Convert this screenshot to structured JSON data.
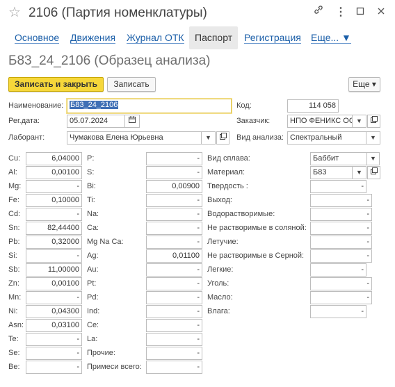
{
  "window": {
    "title": "2106 (Партия номенклатуры)",
    "star_icon": "☆",
    "link_icon": "🔗",
    "more_icon": "⋮",
    "maximize_icon": "☐",
    "close_icon": "✕"
  },
  "tabs": [
    {
      "label": "Основное"
    },
    {
      "label": "Движения"
    },
    {
      "label": "Журнал ОТК"
    },
    {
      "label": "Паспорт",
      "active": true
    },
    {
      "label": "Регистрация"
    },
    {
      "label": "Еще... ▼"
    }
  ],
  "doc_title": "Б83_24_2106 (Образец анализа)",
  "toolbar": {
    "save_close": "Записать и закрыть",
    "save": "Записать",
    "more": "Еще ▾"
  },
  "header": {
    "name_label": "Наименование:",
    "name_value": "Б83_24_2106",
    "code_label": "Код:",
    "code_value": "114 058",
    "reg_label": "Рег.дата:",
    "reg_value": "05.07.2024",
    "customer_label": "Заказчик:",
    "customer_value": "НПО ФЕНИКС ОО",
    "lab_label": "Лаборант:",
    "lab_value": "Чумакова Елена Юрьевна",
    "analysis_label": "Вид анализа:",
    "analysis_value": "Спектральный"
  },
  "col1": [
    {
      "label": "Cu:",
      "value": "6,04000"
    },
    {
      "label": "Al:",
      "value": "0,00100"
    },
    {
      "label": "Mg:",
      "value": "-"
    },
    {
      "label": "Fe:",
      "value": "0,10000"
    },
    {
      "label": "Cd:",
      "value": "-"
    },
    {
      "label": "Sn:",
      "value": "82,44400"
    },
    {
      "label": "Pb:",
      "value": "0,32000"
    },
    {
      "label": "Si:",
      "value": "-"
    },
    {
      "label": "Sb:",
      "value": "11,00000"
    },
    {
      "label": "Zn:",
      "value": "0,00100"
    },
    {
      "label": "Mn:",
      "value": "-"
    },
    {
      "label": "Ni:",
      "value": "0,04300"
    },
    {
      "label": "Asn:",
      "value": "0,03100"
    },
    {
      "label": "Te:",
      "value": "-"
    },
    {
      "label": "Se:",
      "value": "-"
    },
    {
      "label": "Be:",
      "value": "-"
    }
  ],
  "col2": [
    {
      "label": "P:",
      "value": "-"
    },
    {
      "label": "S:",
      "value": "-"
    },
    {
      "label": "Bi:",
      "value": "0,00900"
    },
    {
      "label": "Ti:",
      "value": "-"
    },
    {
      "label": "Na:",
      "value": "-"
    },
    {
      "label": "Ca:",
      "value": "-"
    },
    {
      "label": "Mg Na Ca:",
      "value": "-"
    },
    {
      "label": "Ag:",
      "value": "0,01100"
    },
    {
      "label": "Au:",
      "value": "-"
    },
    {
      "label": "Pt:",
      "value": "-"
    },
    {
      "label": "Pd:",
      "value": "-"
    },
    {
      "label": "Ind:",
      "value": "-"
    },
    {
      "label": "Ce:",
      "value": "-"
    },
    {
      "label": "La:",
      "value": "-"
    },
    {
      "label": "Прочие:",
      "value": "-"
    },
    {
      "label": "Примеси всего:",
      "value": "-"
    }
  ],
  "col3": {
    "alloy_label": "Вид сплава:",
    "alloy_value": "Баббит",
    "material_label": "Материал:",
    "material_value": "Б83",
    "rows": [
      {
        "label": "Твердость :",
        "value": "-"
      },
      {
        "label": "Выход:",
        "value": "-"
      },
      {
        "label": "Водорастворимые:",
        "value": "-"
      },
      {
        "label": "Не растворимые в соляной:",
        "value": "-"
      },
      {
        "label": "Летучие:",
        "value": "-"
      },
      {
        "label": "Не растворимые в Серной:",
        "value": "-"
      },
      {
        "label": "Легкие:",
        "value": "-"
      },
      {
        "label": "Уголь:",
        "value": "-"
      },
      {
        "label": "Масло:",
        "value": "-"
      },
      {
        "label": "Влага:",
        "value": "-"
      }
    ]
  },
  "icons": {
    "calendar": "calendar-icon",
    "open": "open-icon",
    "dropdown": "chevron-down-icon"
  },
  "colors": {
    "accent": "#f6d73a",
    "link": "#1a5ea8",
    "selection": "#3f6fb5"
  }
}
